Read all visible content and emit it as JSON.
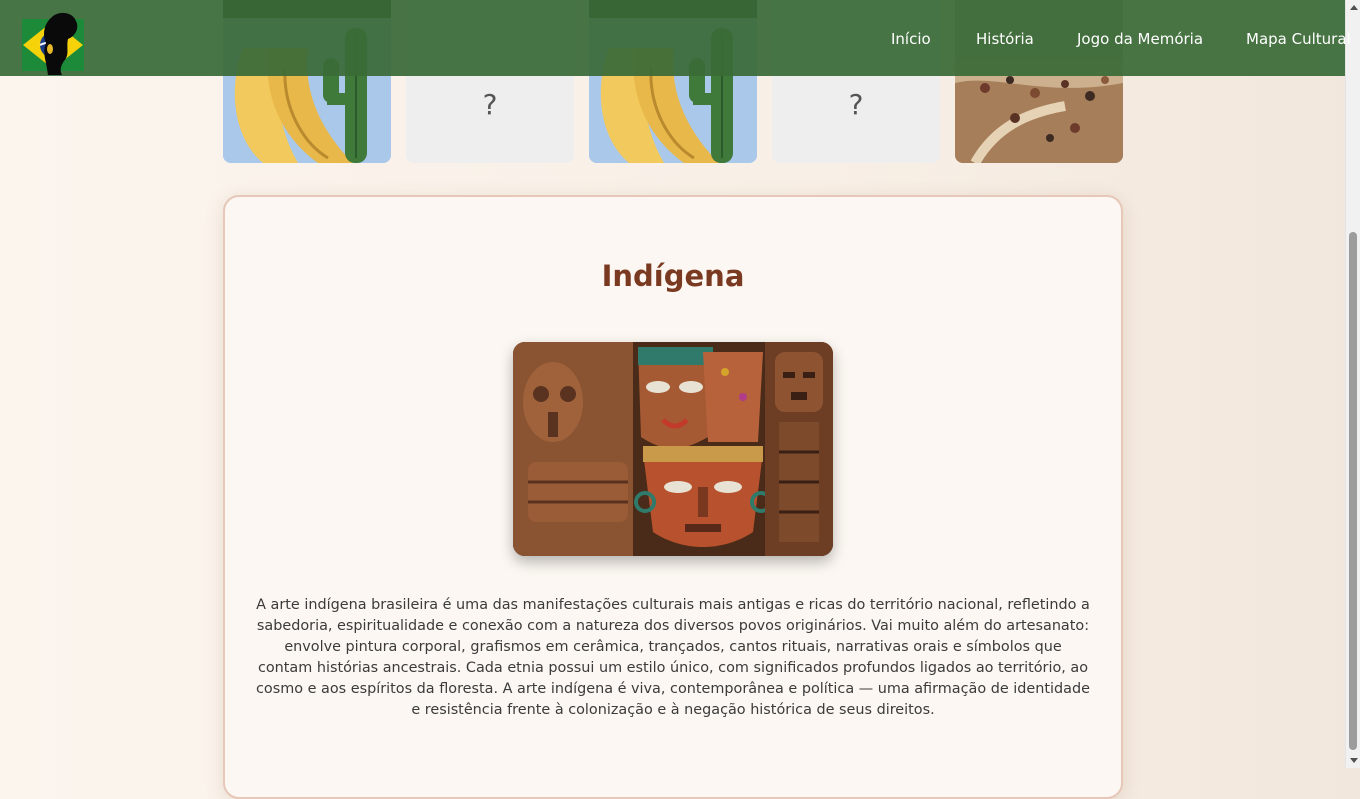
{
  "nav": {
    "items": [
      {
        "label": "Início"
      },
      {
        "label": "História"
      },
      {
        "label": "Jogo da Memória"
      },
      {
        "label": "Mapa Cultural"
      }
    ]
  },
  "memory_cards": [
    {
      "state": "revealed",
      "image": "cactus-painting"
    },
    {
      "state": "hidden",
      "symbol": "?"
    },
    {
      "state": "revealed",
      "image": "cactus-painting"
    },
    {
      "state": "hidden",
      "symbol": "?"
    },
    {
      "state": "revealed",
      "image": "battle-painting"
    }
  ],
  "panel": {
    "title": "Indígena",
    "image": "carved-wooden-masks",
    "description": "A arte indígena brasileira é uma das manifestações culturais mais antigas e ricas do território nacional, refletindo a sabedoria, espiritualidade e conexão com a natureza dos diversos povos originários. Vai muito além do artesanato: envolve pintura corporal, grafismos em cerâmica, trançados, cantos rituais, narrativas orais e símbolos que contam histórias ancestrais. Cada etnia possui um estilo único, com significados profundos ligados ao território, ao cosmo e aos espíritos da floresta. A arte indígena é viva, contemporânea e política — uma afirmação de identidade e resistência frente à colonização e à negação histórica de seus direitos."
  },
  "colors": {
    "header": "#3a6a38",
    "title": "#7a3a22",
    "panel_border": "#e6c7b8",
    "panel_bg": "#fcf7f2"
  }
}
